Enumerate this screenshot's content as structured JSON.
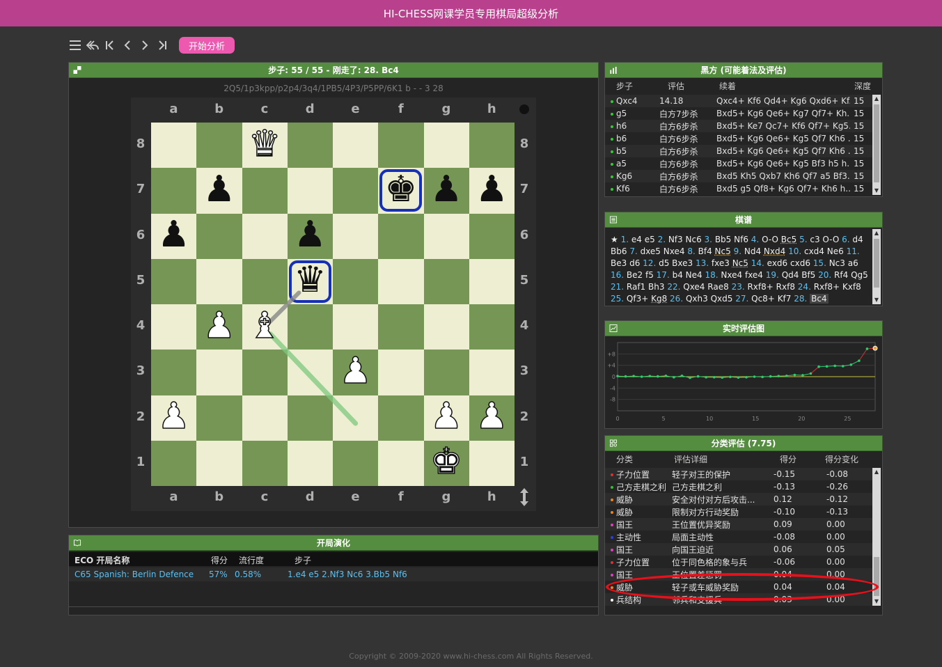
{
  "app": {
    "title": "HI-CHESS网课学员专用棋局超级分析"
  },
  "toolbar": {
    "analyze_label": "开始分析",
    "icons": [
      "menu-icon",
      "undo-icon",
      "first-move-icon",
      "prev-move-icon",
      "next-move-icon",
      "last-move-icon"
    ]
  },
  "board_panel": {
    "title": "步子: 55 / 55 - 刚走了: 28. Bc4",
    "fen": "2Q5/1p3kpp/p2p4/3q4/1PB5/4P3/P5PP/6K1 b - - 3 28",
    "files": [
      "a",
      "b",
      "c",
      "d",
      "e",
      "f",
      "g",
      "h"
    ],
    "ranks": [
      "8",
      "7",
      "6",
      "5",
      "4",
      "3",
      "2",
      "1"
    ],
    "colors": {
      "light": "#eeeed2",
      "dark": "#769656",
      "selection": "#1630b8",
      "arrow": "#7fc97f"
    },
    "pieces": [
      {
        "sq": "c8",
        "glyph": "♛",
        "side": "w",
        "name": "white-queen"
      },
      {
        "sq": "b7",
        "glyph": "♟",
        "side": "b",
        "name": "black-pawn"
      },
      {
        "sq": "f7",
        "glyph": "♚",
        "side": "b",
        "name": "black-king"
      },
      {
        "sq": "g7",
        "glyph": "♟",
        "side": "b",
        "name": "black-pawn"
      },
      {
        "sq": "h7",
        "glyph": "♟",
        "side": "b",
        "name": "black-pawn"
      },
      {
        "sq": "a6",
        "glyph": "♟",
        "side": "b",
        "name": "black-pawn"
      },
      {
        "sq": "d6",
        "glyph": "♟",
        "side": "b",
        "name": "black-pawn"
      },
      {
        "sq": "d5",
        "glyph": "♛",
        "side": "b",
        "name": "black-queen"
      },
      {
        "sq": "b4",
        "glyph": "♟",
        "side": "w",
        "name": "white-pawn"
      },
      {
        "sq": "c4",
        "glyph": "♝",
        "side": "w",
        "name": "white-bishop"
      },
      {
        "sq": "e3",
        "glyph": "♟",
        "side": "w",
        "name": "white-pawn"
      },
      {
        "sq": "a2",
        "glyph": "♟",
        "side": "w",
        "name": "white-pawn"
      },
      {
        "sq": "g2",
        "glyph": "♟",
        "side": "w",
        "name": "white-pawn"
      },
      {
        "sq": "h2",
        "glyph": "♟",
        "side": "w",
        "name": "white-pawn"
      },
      {
        "sq": "g1",
        "glyph": "♚",
        "side": "w",
        "name": "white-king"
      }
    ],
    "selected": [
      "f7",
      "d5"
    ]
  },
  "black_panel": {
    "title": "黑方 (可能着法及评估)",
    "headers": [
      "步子",
      "评估",
      "续着",
      "深度"
    ],
    "rows": [
      {
        "move": "Qxc4",
        "eval": "14.18",
        "line": "Qxc4+ Kf6 Qd4+ Kg6 Qxd6+ Kf...",
        "depth": "15"
      },
      {
        "move": "g5",
        "eval": "白方7步杀",
        "line": "Bxd5+ Kg6 Qe6+ Kg7 Qf7+ Kh...",
        "depth": "15"
      },
      {
        "move": "h6",
        "eval": "白方6步杀",
        "line": "Bxd5+ Ke7 Qc7+ Kf6 Qf7+ Kg5...",
        "depth": "15"
      },
      {
        "move": "b6",
        "eval": "白方6步杀",
        "line": "Bxd5+ Kg6 Qe6+ Kg5 Qf7 Kh6 ...",
        "depth": "15"
      },
      {
        "move": "b5",
        "eval": "白方6步杀",
        "line": "Bxd5+ Kg6 Qe6+ Kg5 Qf7 Kh6 ...",
        "depth": "15"
      },
      {
        "move": "a5",
        "eval": "白方6步杀",
        "line": "Bxd5+ Kg6 Qe6+ Kg5 Bf3 h5 h...",
        "depth": "15"
      },
      {
        "move": "Kg6",
        "eval": "白方6步杀",
        "line": "Bxd5 Kh5 Qxb7 Kh6 Qf7 a5 Bf3...",
        "depth": "15"
      },
      {
        "move": "Kf6",
        "eval": "白方6步杀",
        "line": "Bxd5 g5 Qf8+ Kg6 Qf7+ Kh6 h...",
        "depth": "15"
      }
    ]
  },
  "notation_panel": {
    "title": "棋谱",
    "moves": [
      {
        "n": "1.",
        "w": "e4",
        "b": "e5"
      },
      {
        "n": "2.",
        "w": "Nf3",
        "b": "Nc6"
      },
      {
        "n": "3.",
        "w": "Bb5",
        "b": "Nf6"
      },
      {
        "n": "4.",
        "w": "O-O",
        "b": "Bc5"
      },
      {
        "n": "5.",
        "w": "c3",
        "b": "O-O"
      },
      {
        "n": "6.",
        "w": "d4",
        "b": "Bb6"
      },
      {
        "n": "7.",
        "w": "dxe5",
        "b": "Nxe4"
      },
      {
        "n": "8.",
        "w": "Bf4",
        "b": "Nc5"
      },
      {
        "n": "9.",
        "w": "Nd4",
        "b": "Nxd4"
      },
      {
        "n": "10.",
        "w": "cxd4",
        "b": "Ne6"
      },
      {
        "n": "11.",
        "w": "Be3",
        "b": "d6"
      },
      {
        "n": "12.",
        "w": "d5",
        "b": "Bxe3"
      },
      {
        "n": "13.",
        "w": "fxe3",
        "b": "Nc5"
      },
      {
        "n": "14.",
        "w": "exd6",
        "b": "cxd6"
      },
      {
        "n": "15.",
        "w": "Nc3",
        "b": "a6"
      },
      {
        "n": "16.",
        "w": "Be2",
        "b": "f5"
      },
      {
        "n": "17.",
        "w": "b4",
        "b": "Ne4"
      },
      {
        "n": "18.",
        "w": "Nxe4",
        "b": "fxe4"
      },
      {
        "n": "19.",
        "w": "Qd4",
        "b": "Bf5"
      },
      {
        "n": "20.",
        "w": "Rf4",
        "b": "Qg5"
      },
      {
        "n": "21.",
        "w": "Raf1",
        "b": "Bh3"
      },
      {
        "n": "22.",
        "w": "Qxe4",
        "b": "Rae8"
      },
      {
        "n": "23.",
        "w": "Rxf8+",
        "b": "Rxf8"
      },
      {
        "n": "24.",
        "w": "Rxf8+",
        "b": "Kxf8"
      },
      {
        "n": "25.",
        "w": "Qf3+",
        "b": "Kg8"
      },
      {
        "n": "26.",
        "w": "Qxh3",
        "b": "Qxd5"
      },
      {
        "n": "27.",
        "w": "Qc8+",
        "b": "Kf7"
      },
      {
        "n": "28.",
        "w": "Bc4",
        "b": ""
      }
    ]
  },
  "eval_panel": {
    "title": "实时评估图"
  },
  "chart_data": {
    "type": "line",
    "x": [
      0,
      1,
      2,
      3,
      4,
      5,
      6,
      7,
      8,
      9,
      10,
      11,
      12,
      13,
      14,
      15,
      16,
      17,
      18,
      19,
      20,
      21,
      22,
      23,
      24,
      25,
      26,
      27,
      28
    ],
    "values": [
      0.2,
      0.1,
      0.2,
      0.0,
      0.2,
      0.1,
      0.3,
      -0.2,
      0.3,
      -0.4,
      0.1,
      -0.2,
      -0.2,
      -0.3,
      -0.1,
      -0.3,
      -0.2,
      0.0,
      -0.1,
      0.1,
      0.2,
      0.3,
      0.6,
      0.5,
      1.1,
      3.5,
      3.6,
      3.8,
      3.7,
      4.2,
      5.6,
      9.8,
      14.2
    ],
    "xticks": [
      "0",
      "5",
      "10",
      "15",
      "20",
      "25"
    ],
    "yticks": [
      "+8",
      "+4",
      "0",
      "-4",
      "-8"
    ],
    "ylim": [
      -12,
      12
    ],
    "xlim": [
      0,
      28
    ],
    "colors": {
      "line": "#2ecc71",
      "jump": "#e03030",
      "zero": "#c8c040"
    }
  },
  "category_panel": {
    "title": "分类评估 (7.75)",
    "headers": [
      "分类",
      "评估详细",
      "得分",
      "得分变化"
    ],
    "rows": [
      {
        "cat": "子力位置",
        "detail": "轻子对王的保护",
        "score": "-0.15",
        "delta": "-0.08",
        "color": "#e03030"
      },
      {
        "cat": "己方走棋之利",
        "detail": "己方走棋之利",
        "score": "-0.13",
        "delta": "-0.26",
        "color": "#30c030"
      },
      {
        "cat": "威胁",
        "detail": "安全对付对方后攻击...",
        "score": "0.12",
        "delta": "-0.12",
        "color": "#f08020"
      },
      {
        "cat": "威胁",
        "detail": "限制对方行动奖励",
        "score": "-0.10",
        "delta": "-0.13",
        "color": "#f08020"
      },
      {
        "cat": "国王",
        "detail": "王位置优异奖励",
        "score": "0.09",
        "delta": "0.00",
        "color": "#e040c0"
      },
      {
        "cat": "主动性",
        "detail": "局面主动性",
        "score": "-0.08",
        "delta": "0.00",
        "color": "#3040e0"
      },
      {
        "cat": "国王",
        "detail": "向国王迫近",
        "score": "0.06",
        "delta": "0.05",
        "color": "#e040c0"
      },
      {
        "cat": "子力位置",
        "detail": "位于同色格的象与兵",
        "score": "-0.06",
        "delta": "0.00",
        "color": "#e03030"
      },
      {
        "cat": "国王",
        "detail": "王位置差惩罚",
        "score": "0.04",
        "delta": "0.00",
        "color": "#e040c0"
      },
      {
        "cat": "威胁",
        "detail": "轻子或车威胁奖励",
        "score": "0.04",
        "delta": "0.04",
        "color": "#f08020"
      },
      {
        "cat": "兵结构",
        "detail": "邻兵和支援兵",
        "score": "0.03",
        "delta": "0.00",
        "color": "#ffffff"
      }
    ]
  },
  "opening_panel": {
    "title": "开局演化",
    "headers": [
      "ECO 开局名称",
      "得分",
      "流行度",
      "步子"
    ],
    "rows": [
      {
        "name": "C65 Spanish: Berlin Defence",
        "score": "57%",
        "pop": "0.58%",
        "moves": "1.e4 e5 2.Nf3 Nc6 3.Bb5 Nf6"
      }
    ]
  },
  "footer": {
    "copyright": "Copyright © 2009-2020 www.hi-chess.com All Rights Reserved."
  }
}
